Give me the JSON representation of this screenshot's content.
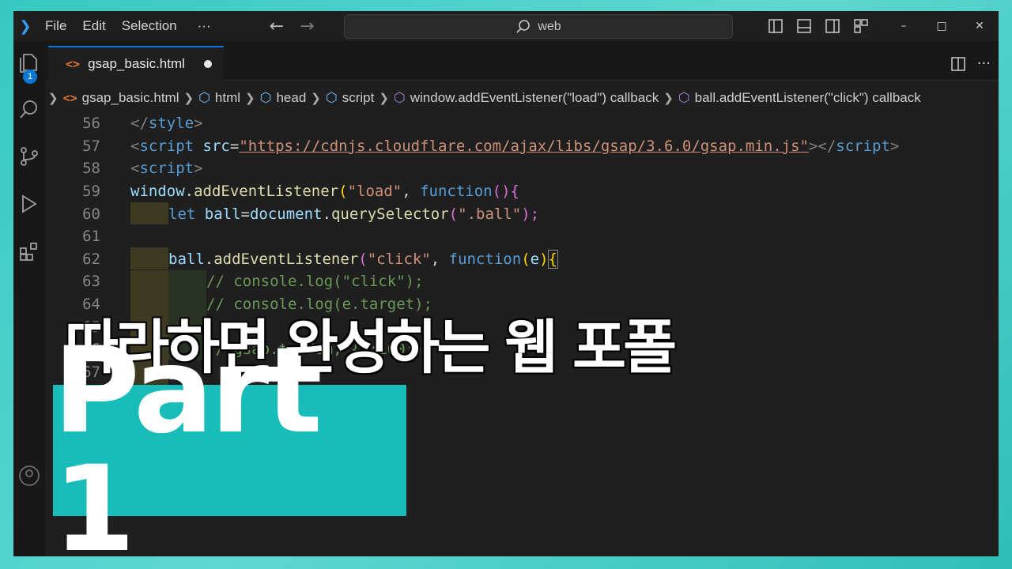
{
  "titlebar": {
    "menu": [
      "File",
      "Edit",
      "Selection",
      "···"
    ],
    "search": "web",
    "window_controls": [
      "–",
      "□",
      "✕"
    ]
  },
  "activity": {
    "source_control_badge": "1"
  },
  "tab": {
    "filename": "gsap_basic.html"
  },
  "breadcrumb": [
    "gsap_basic.html",
    "html",
    "head",
    "script",
    "window.addEventListener(\"load\") callback",
    "ball.addEventListener(\"click\") callback"
  ],
  "code": {
    "line_numbers": [
      "56",
      "57",
      "58",
      "59",
      "60",
      "61",
      "62",
      "63",
      "64",
      "65",
      "66",
      "67"
    ],
    "l56": {
      "a": "</",
      "b": "style",
      "c": ">"
    },
    "l57": {
      "a": "<",
      "b": "script",
      "c": " src",
      "d": "=",
      "e": "\"https://cdnjs.cloudflare.com/ajax/libs/gsap/3.6.0/gsap.min.js\"",
      "f": "></",
      "g": "script",
      "h": ">"
    },
    "l58": {
      "a": "<",
      "b": "script",
      "c": ">"
    },
    "l59": {
      "a": "window",
      "b": ".",
      "c": "addEventListener",
      "d": "(",
      "e": "\"load\"",
      "f": ", ",
      "g": "function",
      "h": "()",
      "i": "{"
    },
    "l60": {
      "a": "let",
      "b": " ball",
      "c": "=",
      "d": "document",
      "e": ".",
      "f": "querySelector",
      "g": "(",
      "h": "\".ball\"",
      "i": ");"
    },
    "l62": {
      "a": "ball",
      "b": ".",
      "c": "addEventListener",
      "d": "(",
      "e": "\"click\"",
      "f": ", ",
      "g": "function",
      "h": "(",
      "i": "e",
      "j": ")",
      "k": "{"
    },
    "l63": "// console.log(\"click\");",
    "l64": "// console.log(e.target);",
    "l66": "// gsap.to(dom, {x:100})",
    "l67": "});"
  },
  "overlay": {
    "headline": "따라하면 완성하는 웹 포폴",
    "part": "Part 1",
    "part_bg": "#18bdb9"
  }
}
